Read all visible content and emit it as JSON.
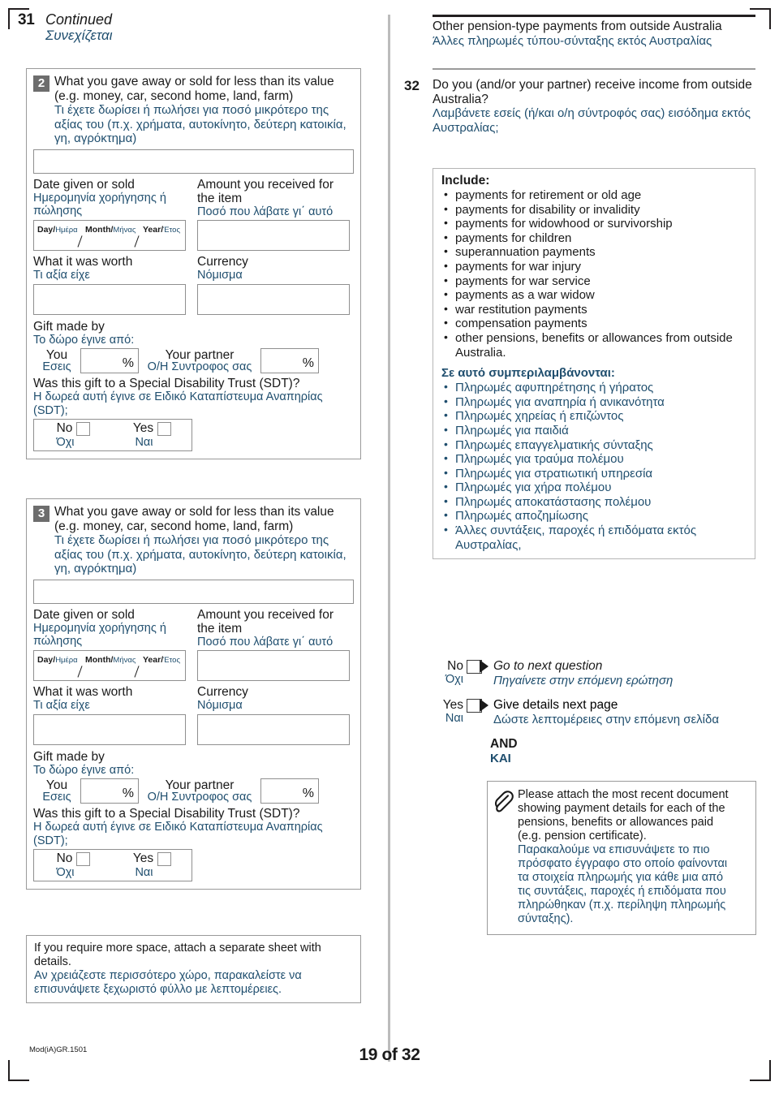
{
  "page": {
    "continued_number": "31",
    "continued_en": "Continued",
    "continued_gr": "Συνεχίζεται",
    "footer_code": "Mod(iA)GR.1501",
    "footer_page": "19 of 32"
  },
  "labels": {
    "date_given_en": "Date given or sold",
    "date_given_gr1": "Ημερομηνία χορήγησης ή",
    "date_given_gr2": "πώλησης",
    "amount_en1": "Amount you received for",
    "amount_en2": "the item",
    "amount_gr": "Ποσό που λάβατε γι΄ αυτό",
    "day": "Day/",
    "day_gr": "Ημέρα",
    "month": "Month/",
    "month_gr": "Μήνας",
    "year": "Year/",
    "year_gr": "Έτος",
    "worth_en": "What it was worth",
    "worth_gr": "Τι αξία είχε",
    "currency_en": "Currency",
    "currency_gr": "Νόμισμα",
    "gift_made_en": "Gift made by",
    "gift_made_gr": "Το δώρο έγινε από:",
    "you_en": "You",
    "you_gr": "Εσεις",
    "partner_en": "Your partner",
    "partner_gr": "Ο/Η Συντροφος σας",
    "percent": "%",
    "sdt_en": "Was this gift to a Special Disability Trust (SDT)?",
    "sdt_gr": "Η δωρεά αυτή έγινε σε Ειδικό Καταπίστευμα Αναπηρίας (SDT);",
    "no_en": "No",
    "no_gr": "Όχι",
    "yes_en": "Yes",
    "yes_gr": "Ναι"
  },
  "gift_blocks": [
    {
      "badge": "2",
      "title_en1": "What you gave away or sold for less than its value",
      "title_en2": "(e.g. money, car, second home, land, farm)",
      "title_gr1": "Τι έχετε δωρίσει ή πωλήσει για ποσό μικρότερο της",
      "title_gr2": "αξίας του (π.χ. χρήματα, αυτοκίνητο, δεύτερη κατοικία,",
      "title_gr3": "γη, αγρόκτημα)",
      "description_value": "",
      "date_value": "",
      "amount_value": "",
      "worth_value": "",
      "currency_value": "",
      "you_pct": "",
      "partner_pct": "",
      "sdt_no_checked": false,
      "sdt_yes_checked": false
    },
    {
      "badge": "3",
      "title_en1": "What you gave away or sold for less than its value",
      "title_en2": "(e.g. money, car, second home, land, farm)",
      "title_gr1": "Τι έχετε δωρίσει ή πωλήσει για ποσό μικρότερο της",
      "title_gr2": "αξίας του (π.χ. χρήματα, αυτοκίνητο, δεύτερη κατοικία,",
      "title_gr3": "γη, αγρόκτημα)",
      "description_value": "",
      "date_value": "",
      "amount_value": "",
      "worth_value": "",
      "currency_value": "",
      "you_pct": "",
      "partner_pct": "",
      "sdt_no_checked": false,
      "sdt_yes_checked": false
    }
  ],
  "more_space": {
    "en": "If you require more space, attach a separate sheet with details.",
    "gr1": "Αν χρειάζεστε περισσότερο χώρο, παρακαλείστε να",
    "gr2": "επισυνάψετε ξεχωριστό φύλλο με λεπτομέρειες."
  },
  "right": {
    "section_en": "Other pension-type payments from outside Australia",
    "section_gr": "Άλλες πληρωμές τύπου-σύνταξης εκτός Αυστραλίας",
    "q32_number": "32",
    "q32_en1": "Do you (and/or your partner) receive income from outside",
    "q32_en2": "Australia?",
    "q32_gr1": "Λαμβάνετε εσείς (ή/και ο/η σύντροφός σας) εισόδημα εκτός",
    "q32_gr2": "Αυστραλίας;",
    "include_en_heading": "Include:",
    "include_en_items": [
      "payments for retirement or old age",
      "payments for disability or invalidity",
      "payments for widowhood or survivorship",
      "payments for children",
      "superannuation payments",
      "payments for war injury",
      "payments for war service",
      "payments as a war widow",
      "war restitution payments",
      "compensation payments",
      "other pensions, benefits or allowances from outside Australia."
    ],
    "include_gr_heading": "Σε αυτό συμπεριλαμβάνονται:",
    "include_gr_items": [
      "Πληρωμές αφυπηρέτησης ή γήρατος",
      "Πληρωμές για αναπηρία ή ανικανότητα",
      "Πληρωμές χηρείας ή επιζώντος",
      "Πληρωμές για παιδιά",
      "Πληρωμές επαγγελματικής σύνταξης",
      "Πληρωμές για τραύμα πολέμου",
      "Πληρωμές για στρατιωτική υπηρεσία",
      "Πληρωμές για χήρα πολέμου",
      "Πληρωμές αποκατάστασης πολέμου",
      "Πληρωμές αποζημίωσης",
      "Άλλες συντάξεις, παροχές ή επιδόματα εκτός Αυστραλίας,"
    ],
    "no_en": "No",
    "no_gr": "Όχι",
    "no_action_en": "Go to next question",
    "no_action_gr": "Πηγαίνετε στην επόμενη ερώτηση",
    "yes_en": "Yes",
    "yes_gr": "Ναι",
    "yes_action_en": "Give details next page",
    "yes_action_gr": "Δώστε λεπτομέρειες στην επόμενη σελίδα",
    "and_en": "AND",
    "and_gr": "ΚΑΙ",
    "no_checked": false,
    "yes_checked": false,
    "attach_en1": "Please attach the most recent document",
    "attach_en2": "showing payment details for each of the",
    "attach_en3": "pensions, benefits or allowances paid",
    "attach_en4": "(e.g. pension certificate).",
    "attach_gr1": "Παρακαλούμε να επισυνάψετε το πιο",
    "attach_gr2": "πρόσφατο έγγραφο στο οποίο φαίνονται",
    "attach_gr3": "τα στοιχεία πληρωμής για κάθε μια από",
    "attach_gr4": "τις συντάξεις, παροχές ή επιδόματα που",
    "attach_gr5": "πληρώθηκαν (π.χ. περίληψη πληρωμής",
    "attach_gr6": "σύνταξης)."
  },
  "colors": {
    "greek_blue": "#1f4e6e",
    "english_black": "#1a1a1a",
    "badge_gray": "#6d6d6d",
    "border_gray": "#9a9a9a"
  }
}
